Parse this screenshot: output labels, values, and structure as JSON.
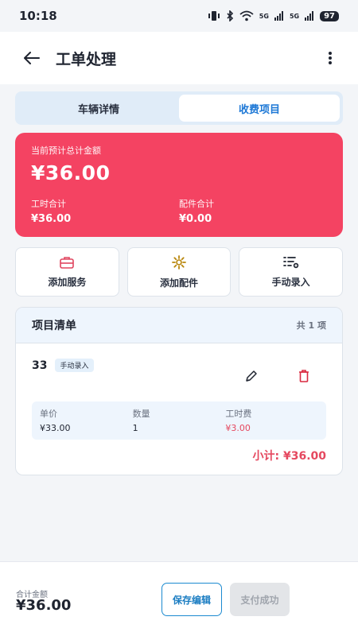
{
  "status_bar": {
    "time": "10:18",
    "battery": "97",
    "network_1": "5G",
    "network_2": "5G"
  },
  "header": {
    "title": "工单处理"
  },
  "tabs": [
    {
      "label": "车辆详情",
      "active": false
    },
    {
      "label": "收费项目",
      "active": true
    }
  ],
  "summary": {
    "estimate_label": "当前预计总计金额",
    "estimate_total": "¥36.00",
    "labor_label": "工时合计",
    "labor_value": "¥36.00",
    "parts_label": "配件合计",
    "parts_value": "¥0.00",
    "color": "#f44362"
  },
  "actions": [
    {
      "label": "添加服务",
      "icon": "toolbox-icon"
    },
    {
      "label": "添加配件",
      "icon": "gear-icon"
    },
    {
      "label": "手动录入",
      "icon": "list-add-icon"
    }
  ],
  "item_list": {
    "title": "项目清单",
    "count": "共 1 项",
    "items": [
      {
        "name": "33",
        "badge": "手动录入",
        "unit_price_label": "单价",
        "unit_price": "¥33.00",
        "quantity_label": "数量",
        "quantity": "1",
        "labor_fee_label": "工时费",
        "labor_fee": "¥3.00",
        "subtotal": "小计: ¥36.00"
      }
    ]
  },
  "footer": {
    "total_label": "合计金额",
    "total": "¥36.00",
    "save_label": "保存编辑",
    "paid_label": "支付成功"
  }
}
